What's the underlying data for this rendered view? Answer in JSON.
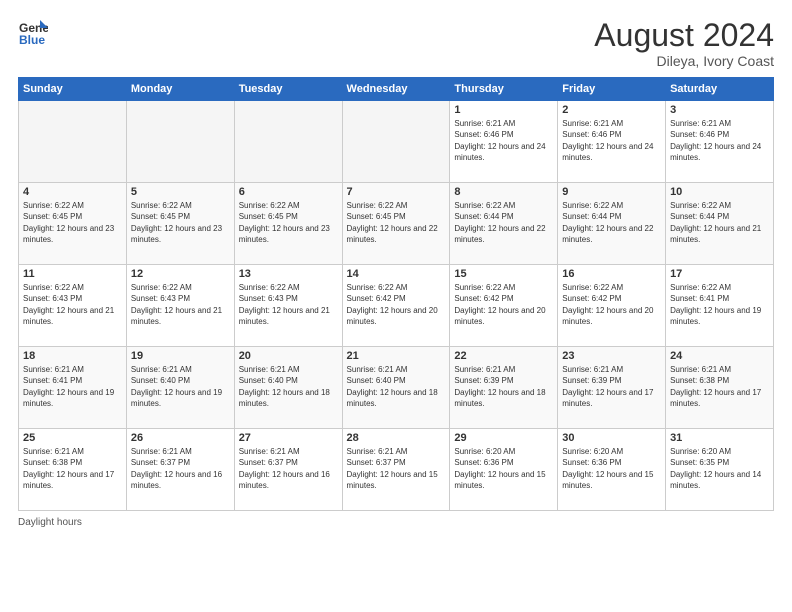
{
  "header": {
    "logo_general": "General",
    "logo_blue": "Blue",
    "month_year": "August 2024",
    "location": "Dileya, Ivory Coast"
  },
  "weekdays": [
    "Sunday",
    "Monday",
    "Tuesday",
    "Wednesday",
    "Thursday",
    "Friday",
    "Saturday"
  ],
  "weeks": [
    [
      {
        "day": "",
        "empty": true
      },
      {
        "day": "",
        "empty": true
      },
      {
        "day": "",
        "empty": true
      },
      {
        "day": "",
        "empty": true
      },
      {
        "day": "1",
        "sunrise": "6:21 AM",
        "sunset": "6:46 PM",
        "daylight": "12 hours and 24 minutes."
      },
      {
        "day": "2",
        "sunrise": "6:21 AM",
        "sunset": "6:46 PM",
        "daylight": "12 hours and 24 minutes."
      },
      {
        "day": "3",
        "sunrise": "6:21 AM",
        "sunset": "6:46 PM",
        "daylight": "12 hours and 24 minutes."
      }
    ],
    [
      {
        "day": "4",
        "sunrise": "6:22 AM",
        "sunset": "6:45 PM",
        "daylight": "12 hours and 23 minutes."
      },
      {
        "day": "5",
        "sunrise": "6:22 AM",
        "sunset": "6:45 PM",
        "daylight": "12 hours and 23 minutes."
      },
      {
        "day": "6",
        "sunrise": "6:22 AM",
        "sunset": "6:45 PM",
        "daylight": "12 hours and 23 minutes."
      },
      {
        "day": "7",
        "sunrise": "6:22 AM",
        "sunset": "6:45 PM",
        "daylight": "12 hours and 22 minutes."
      },
      {
        "day": "8",
        "sunrise": "6:22 AM",
        "sunset": "6:44 PM",
        "daylight": "12 hours and 22 minutes."
      },
      {
        "day": "9",
        "sunrise": "6:22 AM",
        "sunset": "6:44 PM",
        "daylight": "12 hours and 22 minutes."
      },
      {
        "day": "10",
        "sunrise": "6:22 AM",
        "sunset": "6:44 PM",
        "daylight": "12 hours and 21 minutes."
      }
    ],
    [
      {
        "day": "11",
        "sunrise": "6:22 AM",
        "sunset": "6:43 PM",
        "daylight": "12 hours and 21 minutes."
      },
      {
        "day": "12",
        "sunrise": "6:22 AM",
        "sunset": "6:43 PM",
        "daylight": "12 hours and 21 minutes."
      },
      {
        "day": "13",
        "sunrise": "6:22 AM",
        "sunset": "6:43 PM",
        "daylight": "12 hours and 21 minutes."
      },
      {
        "day": "14",
        "sunrise": "6:22 AM",
        "sunset": "6:42 PM",
        "daylight": "12 hours and 20 minutes."
      },
      {
        "day": "15",
        "sunrise": "6:22 AM",
        "sunset": "6:42 PM",
        "daylight": "12 hours and 20 minutes."
      },
      {
        "day": "16",
        "sunrise": "6:22 AM",
        "sunset": "6:42 PM",
        "daylight": "12 hours and 20 minutes."
      },
      {
        "day": "17",
        "sunrise": "6:22 AM",
        "sunset": "6:41 PM",
        "daylight": "12 hours and 19 minutes."
      }
    ],
    [
      {
        "day": "18",
        "sunrise": "6:21 AM",
        "sunset": "6:41 PM",
        "daylight": "12 hours and 19 minutes."
      },
      {
        "day": "19",
        "sunrise": "6:21 AM",
        "sunset": "6:40 PM",
        "daylight": "12 hours and 19 minutes."
      },
      {
        "day": "20",
        "sunrise": "6:21 AM",
        "sunset": "6:40 PM",
        "daylight": "12 hours and 18 minutes."
      },
      {
        "day": "21",
        "sunrise": "6:21 AM",
        "sunset": "6:40 PM",
        "daylight": "12 hours and 18 minutes."
      },
      {
        "day": "22",
        "sunrise": "6:21 AM",
        "sunset": "6:39 PM",
        "daylight": "12 hours and 18 minutes."
      },
      {
        "day": "23",
        "sunrise": "6:21 AM",
        "sunset": "6:39 PM",
        "daylight": "12 hours and 17 minutes."
      },
      {
        "day": "24",
        "sunrise": "6:21 AM",
        "sunset": "6:38 PM",
        "daylight": "12 hours and 17 minutes."
      }
    ],
    [
      {
        "day": "25",
        "sunrise": "6:21 AM",
        "sunset": "6:38 PM",
        "daylight": "12 hours and 17 minutes."
      },
      {
        "day": "26",
        "sunrise": "6:21 AM",
        "sunset": "6:37 PM",
        "daylight": "12 hours and 16 minutes."
      },
      {
        "day": "27",
        "sunrise": "6:21 AM",
        "sunset": "6:37 PM",
        "daylight": "12 hours and 16 minutes."
      },
      {
        "day": "28",
        "sunrise": "6:21 AM",
        "sunset": "6:37 PM",
        "daylight": "12 hours and 15 minutes."
      },
      {
        "day": "29",
        "sunrise": "6:20 AM",
        "sunset": "6:36 PM",
        "daylight": "12 hours and 15 minutes."
      },
      {
        "day": "30",
        "sunrise": "6:20 AM",
        "sunset": "6:36 PM",
        "daylight": "12 hours and 15 minutes."
      },
      {
        "day": "31",
        "sunrise": "6:20 AM",
        "sunset": "6:35 PM",
        "daylight": "12 hours and 14 minutes."
      }
    ]
  ],
  "footer": {
    "label": "Daylight hours"
  }
}
